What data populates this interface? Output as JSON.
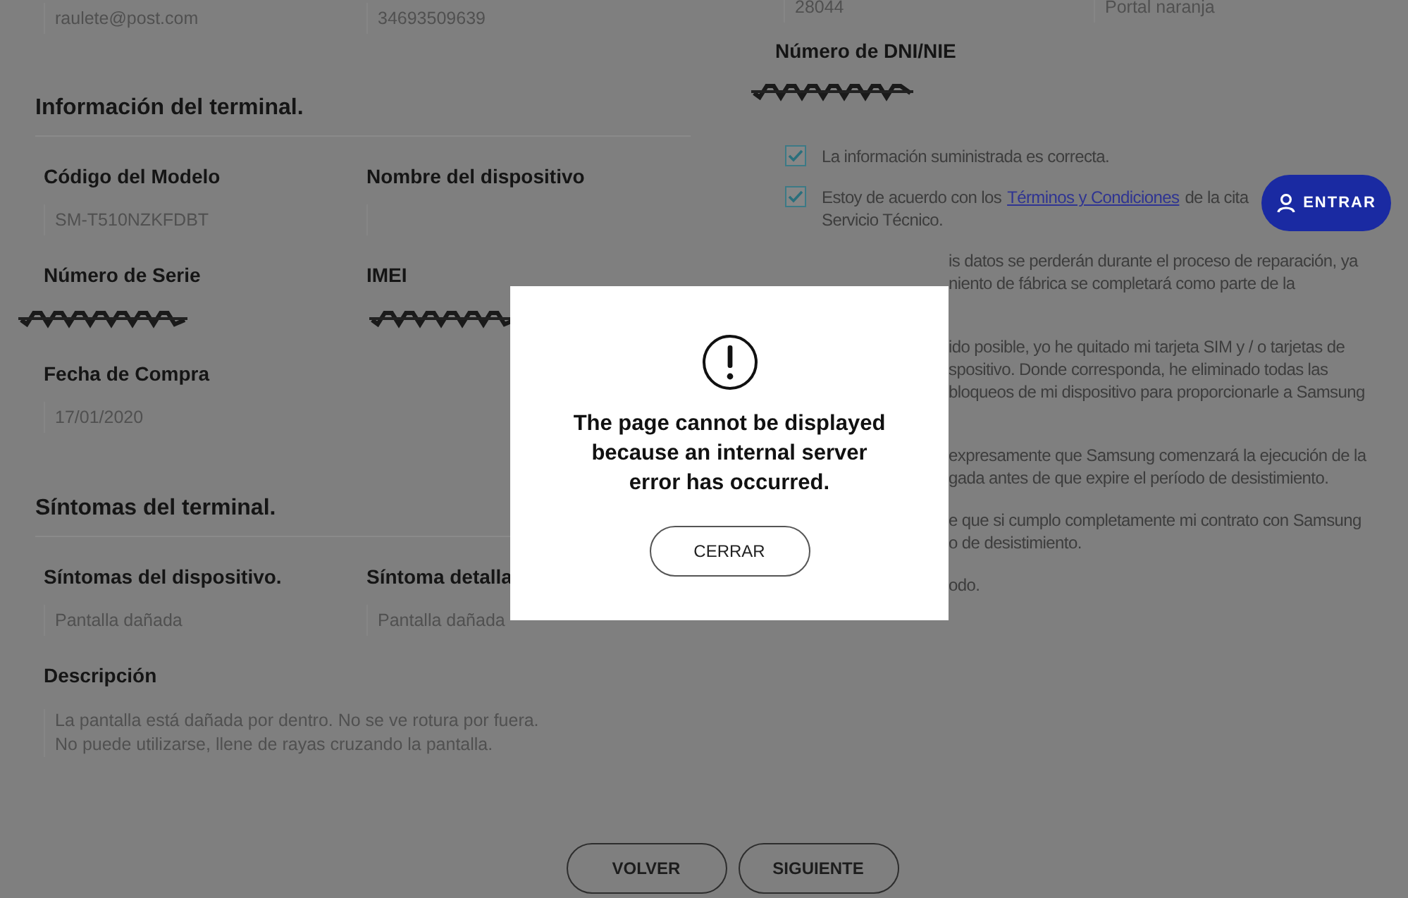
{
  "contact_fields": [
    {
      "value": "raulete@post.com"
    },
    {
      "value": "34693509639"
    }
  ],
  "address_fields": [
    {
      "value": "28044"
    },
    {
      "value": "Portal naranja"
    }
  ],
  "terminal_info": {
    "title": "Información del terminal.",
    "fields": [
      {
        "label": "Código del Modelo",
        "value": "SM-T510NZKFDBT",
        "redacted": false
      },
      {
        "label": "Nombre del dispositivo",
        "redacted": false
      },
      {
        "label": "Número de Serie",
        "redacted": true
      },
      {
        "label": "IMEI",
        "redacted": true
      },
      {
        "label": "Fecha de Compra",
        "value": "17/01/2020",
        "redacted": false
      }
    ]
  },
  "symptoms": {
    "title": "Síntomas del terminal.",
    "fields": [
      {
        "label": "Síntomas del dispositivo.",
        "value": "Pantalla dañada"
      },
      {
        "label": "Síntoma detalla",
        "value": "Pantalla dañada"
      }
    ],
    "description": {
      "label": "Descripción",
      "value": "La pantalla está dañada por dentro. No se ve rotura por fuera.\nNo puede utilizarse, llene de rayas cruzando la pantalla."
    }
  },
  "id_number": {
    "label": "Número de DNI/NIE",
    "redacted": true
  },
  "checklist": [
    {
      "kind": "full",
      "checked": true,
      "text": "La información suministrada es correcta."
    },
    {
      "kind": "terms",
      "checked": true,
      "before": "Estoy de acuerdo con los",
      "link": "Términos y Condiciones",
      "after": "de la cita",
      "continuation": "Servicio Técnico."
    },
    {
      "kind": "clipped",
      "lines": [
        "is datos se perderán durante el proceso de reparación, ya",
        "niento de fábrica se completará como parte de la"
      ]
    },
    {
      "kind": "clipped",
      "lines": [
        "ido posible, yo he quitado mi tarjeta SIM y / o tarjetas de",
        "spositivo. Donde corresponda, he eliminado todas las",
        "bloqueos de mi dispositivo para proporcionarle a Samsung"
      ]
    },
    {
      "kind": "clipped",
      "lines": [
        "expresamente que Samsung comenzará la ejecución de la",
        "gada antes de que expire el período de desistimiento."
      ]
    },
    {
      "kind": "clipped",
      "lines": [
        "e que si cumplo completamente mi contrato con Samsung",
        "o de desistimiento."
      ]
    },
    {
      "kind": "clipped",
      "lines": [
        "odo."
      ]
    }
  ],
  "footer_buttons": [
    "VOLVER",
    "SIGUIENTE"
  ],
  "login_button": {
    "label": "ENTRAR"
  },
  "error_dialog": {
    "message": "The page cannot be displayed because an internal server error has occurred.",
    "button": "CERRAR"
  }
}
